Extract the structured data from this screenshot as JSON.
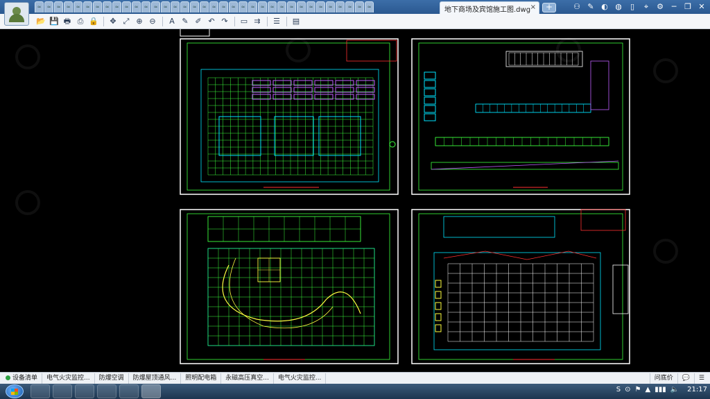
{
  "window": {
    "active_tab_title": "地下商场及宾馆施工图.dwg",
    "active_tab_close": "×",
    "add_tab": "+",
    "mini_tab_count": 35,
    "mini_tab_glyph": "≈",
    "window_controls": [
      "⚇",
      "✎",
      "◐",
      "◍",
      "▯",
      "⌖",
      "⚙",
      "─",
      "❐",
      "✕"
    ]
  },
  "toolbar": {
    "groups": [
      [
        "open-icon",
        "save-icon",
        "print-icon",
        "export-pdf-icon",
        "lock-icon"
      ],
      [
        "pan-icon",
        "zoom-realtime-icon",
        "zoom-in-icon",
        "zoom-out-icon"
      ],
      [
        "text-icon",
        "pencil-icon",
        "highlighter-icon",
        "undo-icon",
        "redo-icon"
      ],
      [
        "measure-icon",
        "dimension-icon"
      ],
      [
        "layers-icon"
      ],
      [
        "properties-icon"
      ]
    ],
    "glyphs": {
      "open-icon": "📂",
      "save-icon": "💾",
      "print-icon": "🖶",
      "export-pdf-icon": "⎙",
      "lock-icon": "🔒",
      "pan-icon": "✥",
      "zoom-realtime-icon": "⤢",
      "zoom-in-icon": "⊕",
      "zoom-out-icon": "⊖",
      "text-icon": "A",
      "pencil-icon": "✎",
      "highlighter-icon": "✐",
      "undo-icon": "↶",
      "redo-icon": "↷",
      "measure-icon": "▭",
      "dimension-icon": "⇉",
      "layers-icon": "☰",
      "properties-icon": "▤"
    }
  },
  "status_tabs": [
    "设备清单",
    "电气火灾监控...",
    "防爆空调",
    "防爆屋顶通风...",
    "照明配电箱",
    "永磁高压真空...",
    "电气火灾监控..."
  ],
  "status_right": {
    "help": "问底价",
    "chat": "💬",
    "menu": "☰"
  },
  "taskbar": {
    "apps": [
      "browser-app",
      "editor-app",
      "explorer-app",
      "messenger-app",
      "archive-app",
      "cad-app"
    ],
    "tray_icons": [
      "S",
      "⊙",
      "⚑",
      "▲",
      "▮▮▮",
      "🔈"
    ],
    "clock": "21:17"
  },
  "colors": {
    "canvas": "#000000",
    "sheet_border": "#ffffff",
    "cad_green": "#3cff3c",
    "cad_cyan": "#00e5ff",
    "cad_magenta": "#c060ff",
    "cad_yellow": "#ffff40",
    "cad_red": "#ff3030",
    "cad_blue": "#2050ff"
  }
}
